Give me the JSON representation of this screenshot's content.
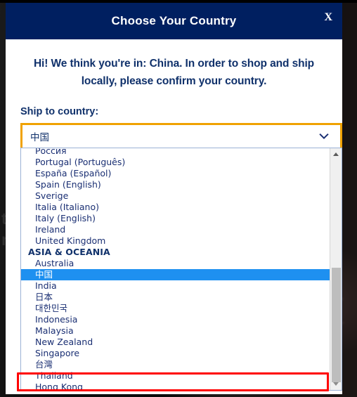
{
  "modal": {
    "title": "Choose Your Country",
    "close_label": "X",
    "message": "Hi! We think you're in: China. In order to shop and ship locally, please confirm your country.",
    "field_label": "Ship to country:",
    "selected_value": "中国",
    "chevron_icon": "chevron-down-icon"
  },
  "dropdown": {
    "items": [
      {
        "label": "Россия",
        "type": "option",
        "selected": false
      },
      {
        "label": "Portugal (Português)",
        "type": "option",
        "selected": false
      },
      {
        "label": "España (Español)",
        "type": "option",
        "selected": false
      },
      {
        "label": "Spain (English)",
        "type": "option",
        "selected": false
      },
      {
        "label": "Sverige",
        "type": "option",
        "selected": false
      },
      {
        "label": "Italia (Italiano)",
        "type": "option",
        "selected": false
      },
      {
        "label": "Italy (English)",
        "type": "option",
        "selected": false
      },
      {
        "label": "Ireland",
        "type": "option",
        "selected": false
      },
      {
        "label": "United Kingdom",
        "type": "option",
        "selected": false
      },
      {
        "label": "ASIA & OCEANIA",
        "type": "group",
        "selected": false
      },
      {
        "label": "Australia",
        "type": "option",
        "selected": false
      },
      {
        "label": "中国",
        "type": "option",
        "selected": true
      },
      {
        "label": "India",
        "type": "option",
        "selected": false
      },
      {
        "label": "日本",
        "type": "option",
        "selected": false
      },
      {
        "label": "대한민국",
        "type": "option",
        "selected": false
      },
      {
        "label": "Indonesia",
        "type": "option",
        "selected": false
      },
      {
        "label": "Malaysia",
        "type": "option",
        "selected": false
      },
      {
        "label": "New Zealand",
        "type": "option",
        "selected": false
      },
      {
        "label": "Singapore",
        "type": "option",
        "selected": false
      },
      {
        "label": "台灣",
        "type": "option",
        "selected": false
      },
      {
        "label": "Thailand",
        "type": "option",
        "selected": false
      },
      {
        "label": "Hong Kong",
        "type": "option",
        "selected": false
      }
    ],
    "scrollbar": {
      "up_icon": "scroll-up-arrow-icon",
      "down_icon": "scroll-down-arrow-icon"
    }
  },
  "annotation": {
    "target_label": "Hong Kong",
    "color": "#ff0000"
  },
  "colors": {
    "header_bg": "#001f60",
    "text_navy": "#10316b",
    "focus_border": "#f0a202",
    "selection_blue": "#1e90f0",
    "annotation_red": "#ff0000"
  },
  "background": {
    "ghost_text": "t t\nn e"
  }
}
